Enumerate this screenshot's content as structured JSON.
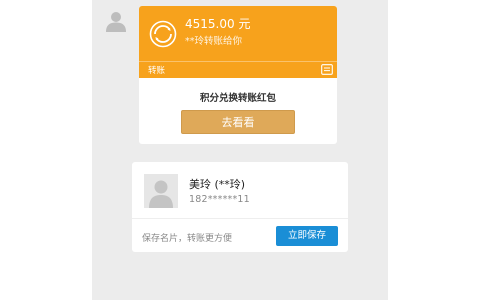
{
  "transfer": {
    "amount": "4515.00 元",
    "subtitle": "**玲转账给你",
    "footer_label": "转账",
    "footer_icon": "wallet-icon",
    "coin_icon": "transfer-exchange-icon",
    "color": "#f7a21c"
  },
  "promo": {
    "title": "积分兑换转账红包",
    "button_label": "去看看",
    "button_color": "#dfa959"
  },
  "contact": {
    "name": "美玲 (**玲)",
    "phone": "182******11",
    "hint": "保存名片，转账更方便",
    "save_label": "立即保存",
    "save_color": "#1a8ed6",
    "avatar_icon": "default-avatar-icon"
  },
  "sender": {
    "avatar_icon": "default-avatar-icon"
  }
}
